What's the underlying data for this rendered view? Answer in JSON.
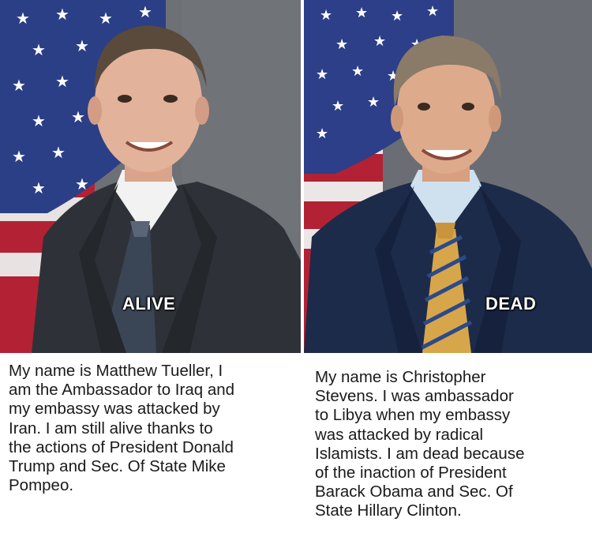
{
  "left": {
    "label": "ALIVE",
    "caption_lines": [
      "My name is Matthew Tueller, I",
      "am the Ambassador to Iraq and",
      "my embassy was attacked by",
      "Iran. I am still alive thanks to",
      "the actions of President Donald",
      "Trump and Sec. Of State Mike",
      "Pompeo."
    ]
  },
  "right": {
    "label": "DEAD",
    "caption_lines": [
      "My name is Christopher",
      "Stevens. I was ambassador",
      "to Libya when my embassy",
      "was attacked by radical",
      "Islamists. I am dead because",
      "of the inaction of President",
      "Barack Obama and Sec. Of",
      "State Hillary Clinton."
    ]
  },
  "colors": {
    "flag_blue": "#2b3f86",
    "flag_red": "#b22234",
    "backdrop_gray": "#6f7378",
    "suit_dark": "#2c3036",
    "suit_navy": "#1c2a48"
  }
}
